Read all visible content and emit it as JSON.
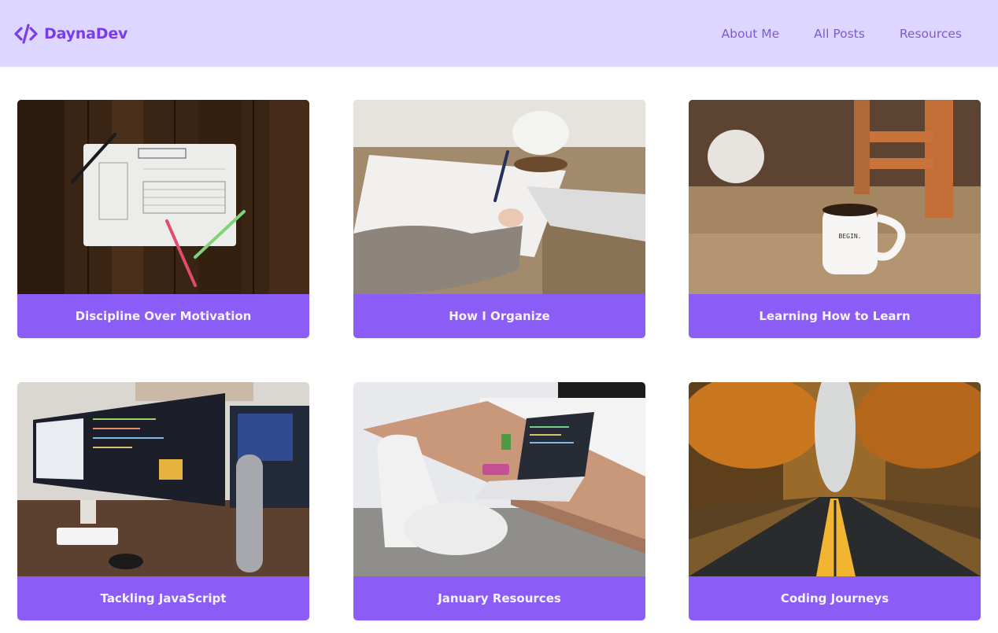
{
  "brand": {
    "name": "DaynaDev",
    "icon": "code-brackets-icon",
    "color": "#7c3aed"
  },
  "nav": {
    "items": [
      {
        "label": "About Me"
      },
      {
        "label": "All Posts"
      },
      {
        "label": "Resources"
      }
    ]
  },
  "colors": {
    "navbar_bg": "#ddd6fe",
    "card_bar": "#8b5cf6",
    "nav_text": "#7c5bd0"
  },
  "posts": [
    {
      "title": "Discipline Over Motivation",
      "image": "goal-review-worksheet-photo"
    },
    {
      "title": "How I Organize",
      "image": "person-writing-notes-photo"
    },
    {
      "title": "Learning How to Learn",
      "image": "begin-coffee-mug-photo"
    },
    {
      "title": "Tackling JavaScript",
      "image": "code-monitor-desk-photo"
    },
    {
      "title": "January Resources",
      "image": "laptop-desk-photo"
    },
    {
      "title": "Coding Journeys",
      "image": "autumn-road-photo"
    }
  ]
}
